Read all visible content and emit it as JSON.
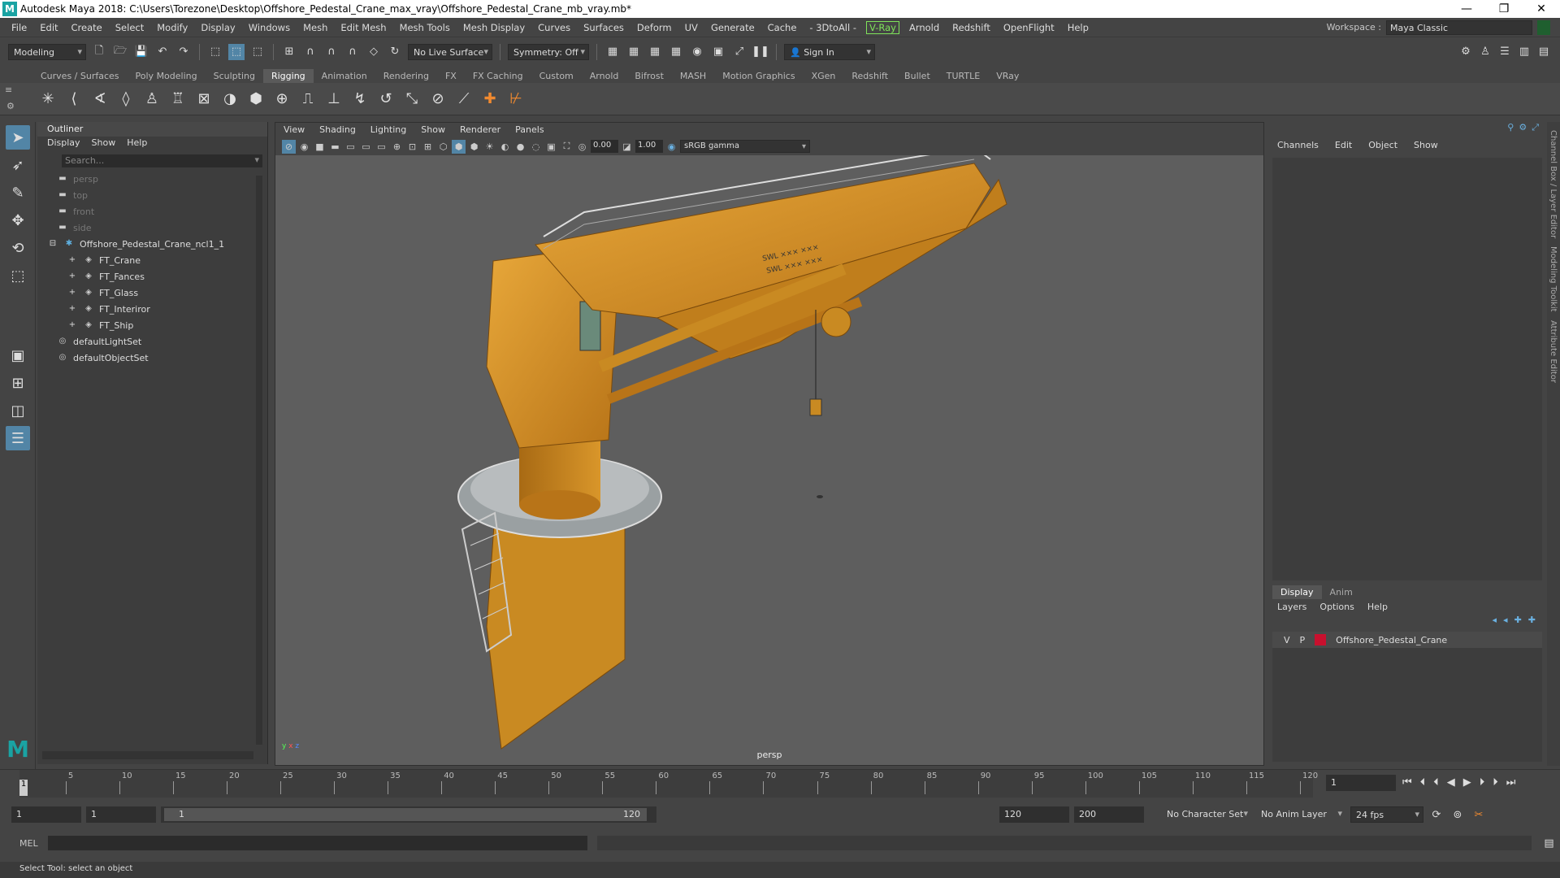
{
  "window": {
    "title": "Autodesk Maya 2018: C:\\Users\\Torezone\\Desktop\\Offshore_Pedestal_Crane_max_vray\\Offshore_Pedestal_Crane_mb_vray.mb*",
    "min": "—",
    "max": "❐",
    "close": "✕"
  },
  "menubar": {
    "items": [
      "File",
      "Edit",
      "Create",
      "Select",
      "Modify",
      "Display",
      "Windows",
      "Mesh",
      "Edit Mesh",
      "Mesh Tools",
      "Mesh Display",
      "Curves",
      "Surfaces",
      "Deform",
      "UV",
      "Generate",
      "Cache",
      "- 3DtoAll -"
    ],
    "vray": "V-Ray",
    "items2": [
      "Arnold",
      "Redshift",
      "OpenFlight",
      "Help"
    ],
    "workspace_label": "Workspace :",
    "workspace_value": "Maya Classic"
  },
  "statusline": {
    "mode": "Modeling",
    "live_surface": "No Live Surface",
    "symmetry": "Symmetry: Off",
    "sign_in": "Sign In"
  },
  "shelf": {
    "tabs": [
      "Curves / Surfaces",
      "Poly Modeling",
      "Sculpting",
      "Rigging",
      "Animation",
      "Rendering",
      "FX",
      "FX Caching",
      "Custom",
      "Arnold",
      "Bifrost",
      "MASH",
      "Motion Graphics",
      "XGen",
      "Redshift",
      "Bullet",
      "TURTLE",
      "VRay"
    ],
    "active": "Rigging"
  },
  "outliner": {
    "title": "Outliner",
    "menu": [
      "Display",
      "Show",
      "Help"
    ],
    "search_placeholder": "Search...",
    "items": [
      {
        "label": "persp",
        "type": "camera",
        "indent": 1,
        "dim": true
      },
      {
        "label": "top",
        "type": "camera",
        "indent": 1,
        "dim": true
      },
      {
        "label": "front",
        "type": "camera",
        "indent": 1,
        "dim": true
      },
      {
        "label": "side",
        "type": "camera",
        "indent": 1,
        "dim": true
      },
      {
        "label": "Offshore_Pedestal_Crane_ncl1_1",
        "type": "root",
        "indent": 0,
        "dim": false
      },
      {
        "label": "FT_Crane",
        "type": "group",
        "indent": 2,
        "dim": false
      },
      {
        "label": "FT_Fances",
        "type": "group",
        "indent": 2,
        "dim": false
      },
      {
        "label": "FT_Glass",
        "type": "group",
        "indent": 2,
        "dim": false
      },
      {
        "label": "FT_Interiror",
        "type": "group",
        "indent": 2,
        "dim": false
      },
      {
        "label": "FT_Ship",
        "type": "group",
        "indent": 2,
        "dim": false
      },
      {
        "label": "defaultLightSet",
        "type": "set",
        "indent": 1,
        "dim": false
      },
      {
        "label": "defaultObjectSet",
        "type": "set",
        "indent": 1,
        "dim": false
      }
    ]
  },
  "viewport": {
    "menu": [
      "View",
      "Shading",
      "Lighting",
      "Show",
      "Renderer",
      "Panels"
    ],
    "exposure": "0.00",
    "gamma": "1.00",
    "colorspace": "sRGB gamma",
    "camera": "persp"
  },
  "channelbox": {
    "menu": [
      "Channels",
      "Edit",
      "Object",
      "Show"
    ],
    "layer_tabs": [
      "Display",
      "Anim"
    ],
    "layer_menu": [
      "Layers",
      "Options",
      "Help"
    ],
    "layer": {
      "v": "V",
      "p": "P",
      "name": "Offshore_Pedestal_Crane",
      "color": "#c8102e"
    }
  },
  "sidetabs": [
    "Channel Box / Layer Editor",
    "Modeling Toolkit",
    "Attribute Editor"
  ],
  "timeline": {
    "ticks": [
      "5",
      "10",
      "15",
      "20",
      "25",
      "30",
      "35",
      "40",
      "45",
      "50",
      "55",
      "60",
      "65",
      "70",
      "75",
      "80",
      "85",
      "90",
      "95",
      "100",
      "105",
      "110",
      "115",
      "120"
    ],
    "current_frame": "1",
    "current_frame_field": "1"
  },
  "range": {
    "start": "1",
    "playback_start": "1",
    "slider_start": "1",
    "slider_end": "120",
    "playback_end": "120",
    "end": "200",
    "character_set": "No Character Set",
    "anim_layer": "No Anim Layer",
    "fps": "24 fps"
  },
  "cmdline": {
    "label": "MEL"
  },
  "helpline": {
    "text": "Select Tool: select an object"
  },
  "colors": {
    "accent": "#5285a6",
    "crane": "#d9962a",
    "layer": "#c8102e"
  }
}
